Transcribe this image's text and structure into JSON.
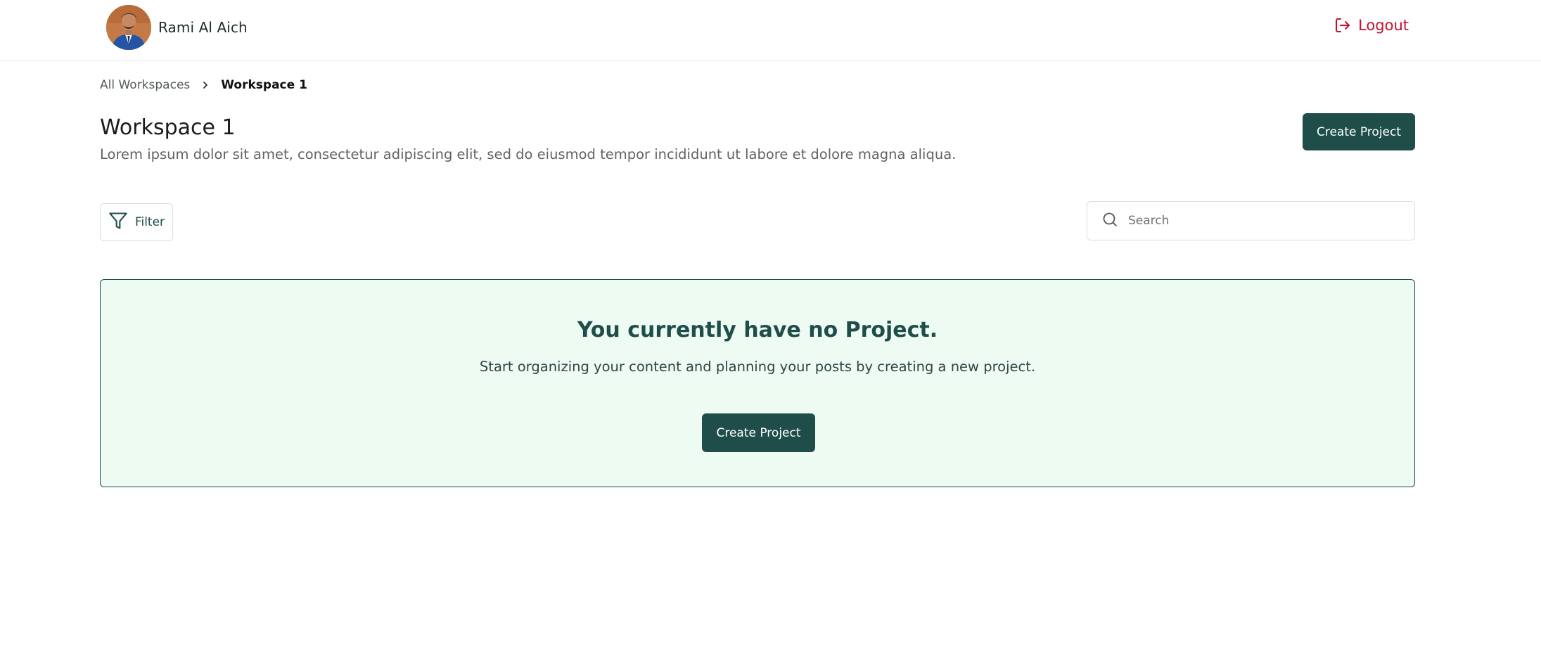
{
  "header": {
    "user_name": "Rami Al Aich",
    "logout_label": "Logout"
  },
  "breadcrumb": {
    "parent": "All Workspaces",
    "current": "Workspace 1"
  },
  "page": {
    "title": "Workspace 1",
    "description": "Lorem ipsum dolor sit amet, consectetur adipiscing elit, sed do eiusmod tempor incididunt ut labore et dolore magna aliqua.",
    "create_button_label": "Create Project"
  },
  "toolbar": {
    "filter_label": "Filter",
    "search_placeholder": "Search",
    "search_value": ""
  },
  "empty_state": {
    "title": "You currently have no Project.",
    "subtitle": "Start organizing your content and planning your posts by creating a new project.",
    "button_label": "Create Project"
  },
  "colors": {
    "primary": "#1f4e4a",
    "logout": "#c8102e",
    "empty_bg": "#eefbf3"
  },
  "icons": {
    "logout": "logout-icon",
    "chevron": "chevron-right-icon",
    "filter": "filter-icon",
    "search": "search-icon"
  }
}
